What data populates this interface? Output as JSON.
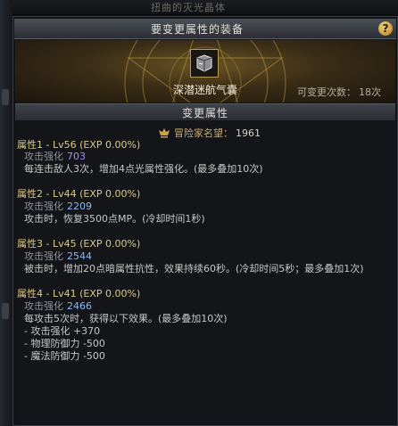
{
  "background": {
    "top_text": "扭曲的灭光晶体"
  },
  "window": {
    "title": "要变更属性的装备",
    "help_label": "?"
  },
  "equipment": {
    "item_name": "深潜迷航气囊",
    "remaining_label": "可变更次数：",
    "remaining_value": "18次"
  },
  "section": {
    "title": "变更属性"
  },
  "fame": {
    "label": "冒险家名望：",
    "value": "1961"
  },
  "attributes": [
    {
      "title": "属性1 - Lv56 (EXP 0.00%)",
      "stat_name": "攻击强化",
      "stat_value": "703",
      "lines": [
        "每连击敌人3次，增加4点光属性强化。(最多叠加10次)"
      ]
    },
    {
      "title": "属性2 - Lv44 (EXP 0.00%)",
      "stat_name": "攻击强化",
      "stat_value": "2209",
      "lines": [
        "攻击时，恢复3500点MP。(冷却时间1秒)"
      ]
    },
    {
      "title": "属性3 - Lv45 (EXP 0.00%)",
      "stat_name": "攻击强化",
      "stat_value": "2544",
      "lines": [
        "被击时，增加20点暗属性抗性，效果持续60秒。(冷却时间5秒；最多叠加1次)"
      ]
    },
    {
      "title": "属性4 - Lv41 (EXP 0.00%)",
      "stat_name": "攻击强化",
      "stat_value": "2466",
      "lines": [
        "每攻击5次时，获得以下效果。(最多叠加10次)",
        "- 攻击强化 +370",
        "- 物理防御力 -500",
        "- 魔法防御力 -500"
      ]
    }
  ],
  "colors": {
    "gold_text": "#d9c98a",
    "purple_value": "#a98bf0",
    "blue_value": "#8fb8f0",
    "help_button": "#d9a53a"
  }
}
